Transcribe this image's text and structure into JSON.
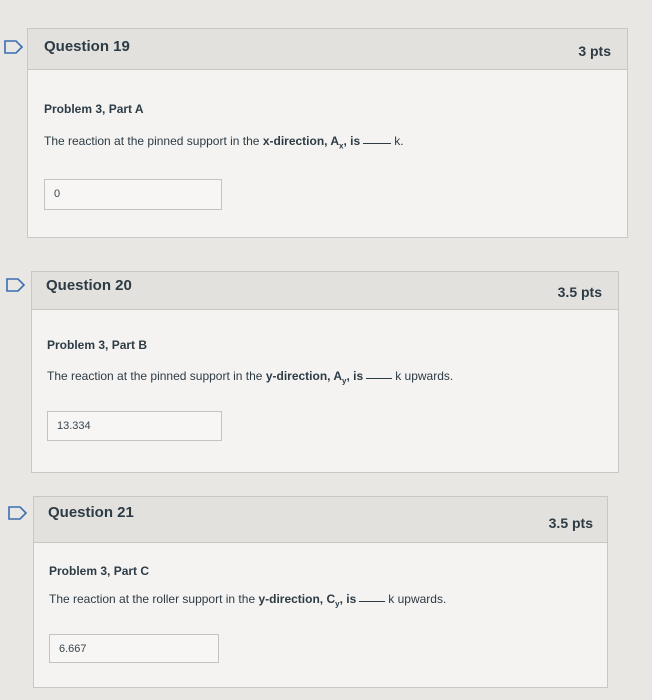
{
  "questions": [
    {
      "title": "Question 19",
      "points": "3 pts",
      "problem": "Problem 3, Part A",
      "stmt_prefix": "The reaction at the pinned support in the ",
      "stmt_bold": "x-direction, A",
      "stmt_sub": "x",
      "stmt_after": ", is",
      "stmt_suffix": "k.",
      "answer": "0"
    },
    {
      "title": "Question 20",
      "points": "3.5 pts",
      "problem": "Problem 3, Part B",
      "stmt_prefix": "The reaction at the pinned support in the ",
      "stmt_bold": "y-direction, A",
      "stmt_sub": "y",
      "stmt_after": ", is",
      "stmt_suffix": "k upwards.",
      "answer": "13.334"
    },
    {
      "title": "Question 21",
      "points": "3.5 pts",
      "problem": "Problem 3, Part C",
      "stmt_prefix": "The reaction at the roller support in the ",
      "stmt_bold": "y-direction, C",
      "stmt_sub": "y",
      "stmt_after": ", is",
      "stmt_suffix": "k upwards.",
      "answer": "6.667"
    }
  ],
  "colors": {
    "flag": "#3a6fb0",
    "card": "#f4f3f1",
    "header": "#e2e1de"
  },
  "icons": {
    "flag": "flag-icon"
  }
}
